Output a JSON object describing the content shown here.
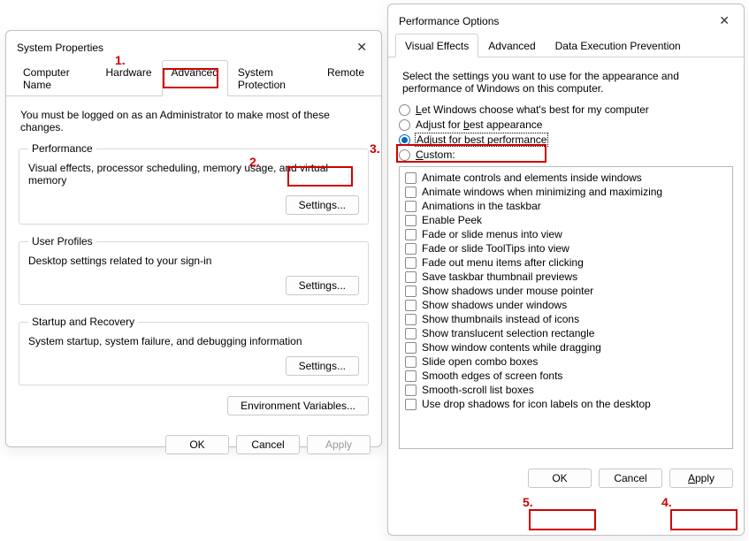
{
  "sysprop": {
    "title": "System Properties",
    "tabs": [
      "Computer Name",
      "Hardware",
      "Advanced",
      "System Protection",
      "Remote"
    ],
    "active_tab": 2,
    "instruction": "You must be logged on as an Administrator to make most of these changes.",
    "perf": {
      "legend": "Performance",
      "desc": "Visual effects, processor scheduling, memory usage, and virtual memory",
      "settings_btn": "Settings..."
    },
    "userprof": {
      "legend": "User Profiles",
      "desc": "Desktop settings related to your sign-in",
      "settings_btn": "Settings..."
    },
    "startup": {
      "legend": "Startup and Recovery",
      "desc": "System startup, system failure, and debugging information",
      "settings_btn": "Settings..."
    },
    "envvars_btn": "Environment Variables...",
    "ok": "OK",
    "cancel": "Cancel",
    "apply": "Apply"
  },
  "perfopt": {
    "title": "Performance Options",
    "tabs": [
      "Visual Effects",
      "Advanced",
      "Data Execution Prevention"
    ],
    "active_tab": 0,
    "instruction": "Select the settings you want to use for the appearance and performance of Windows on this computer.",
    "radios": {
      "let_windows_pre": "",
      "let_windows_u": "L",
      "let_windows_post": "et Windows choose what's best for my computer",
      "best_app_pre": "Adjust for ",
      "best_app_u": "b",
      "best_app_post": "est appearance",
      "best_perf_pre": "Adjust for best ",
      "best_perf_u": "p",
      "best_perf_post": "erformance",
      "custom_u": "C",
      "custom_post": "ustom:"
    },
    "selected_radio": 2,
    "checks": [
      "Animate controls and elements inside windows",
      "Animate windows when minimizing and maximizing",
      "Animations in the taskbar",
      "Enable Peek",
      "Fade or slide menus into view",
      "Fade or slide ToolTips into view",
      "Fade out menu items after clicking",
      "Save taskbar thumbnail previews",
      "Show shadows under mouse pointer",
      "Show shadows under windows",
      "Show thumbnails instead of icons",
      "Show translucent selection rectangle",
      "Show window contents while dragging",
      "Slide open combo boxes",
      "Smooth edges of screen fonts",
      "Smooth-scroll list boxes",
      "Use drop shadows for icon labels on the desktop"
    ],
    "ok": "OK",
    "cancel": "Cancel",
    "apply_u": "A",
    "apply_post": "pply"
  },
  "annotations": {
    "n1": "1.",
    "n2": "2.",
    "n3": "3.",
    "n4": "4.",
    "n5": "5."
  }
}
